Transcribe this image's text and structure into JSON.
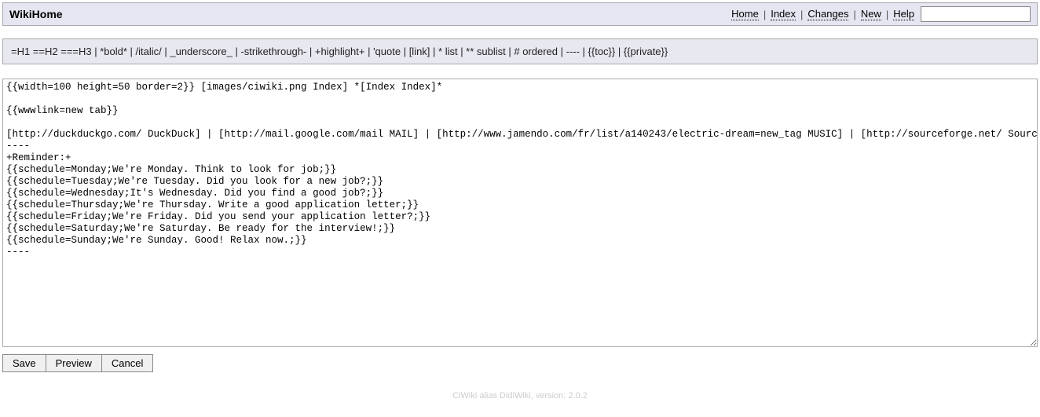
{
  "header": {
    "title": "WikiHome",
    "links": {
      "home": "Home",
      "index": "Index",
      "changes": "Changes",
      "new": "New",
      "help": "Help"
    },
    "separator": "|",
    "search_value": ""
  },
  "hint": "=H1 ==H2 ===H3 | *bold* | /italic/ | _underscore_ | -strikethrough- | +highlight+ | 'quote | [link] | * list | ** sublist | # ordered | ---- | {{toc}} | {{private}}",
  "editor": {
    "content": "{{width=100 height=50 border=2}} [images/ciwiki.png Index] *[Index Index]*\n\n{{wwwlink=new tab}}\n\n[http://duckduckgo.com/ DuckDuck] | [http://mail.google.com/mail MAIL] | [http://www.jamendo.com/fr/list/a140243/electric-dream=new_tag MUSIC] | [http://sourceforge.net/ SourceForge]\n----\n+Reminder:+\n{{schedule=Monday;We're Monday. Think to look for job;}}\n{{schedule=Tuesday;We're Tuesday. Did you look for a new job?;}}\n{{schedule=Wednesday;It's Wednesday. Did you find a good job?;}}\n{{schedule=Thursday;We're Thursday. Write a good application letter;}}\n{{schedule=Friday;We're Friday. Did you send your application letter?;}}\n{{schedule=Saturday;We're Saturday. Be ready for the interview!;}}\n{{schedule=Sunday;We're Sunday. Good! Relax now.;}}\n----"
  },
  "buttons": {
    "save": "Save",
    "preview": "Preview",
    "cancel": "Cancel"
  },
  "footer": "CiWiki alias DidiWiki, version: 2.0.2"
}
